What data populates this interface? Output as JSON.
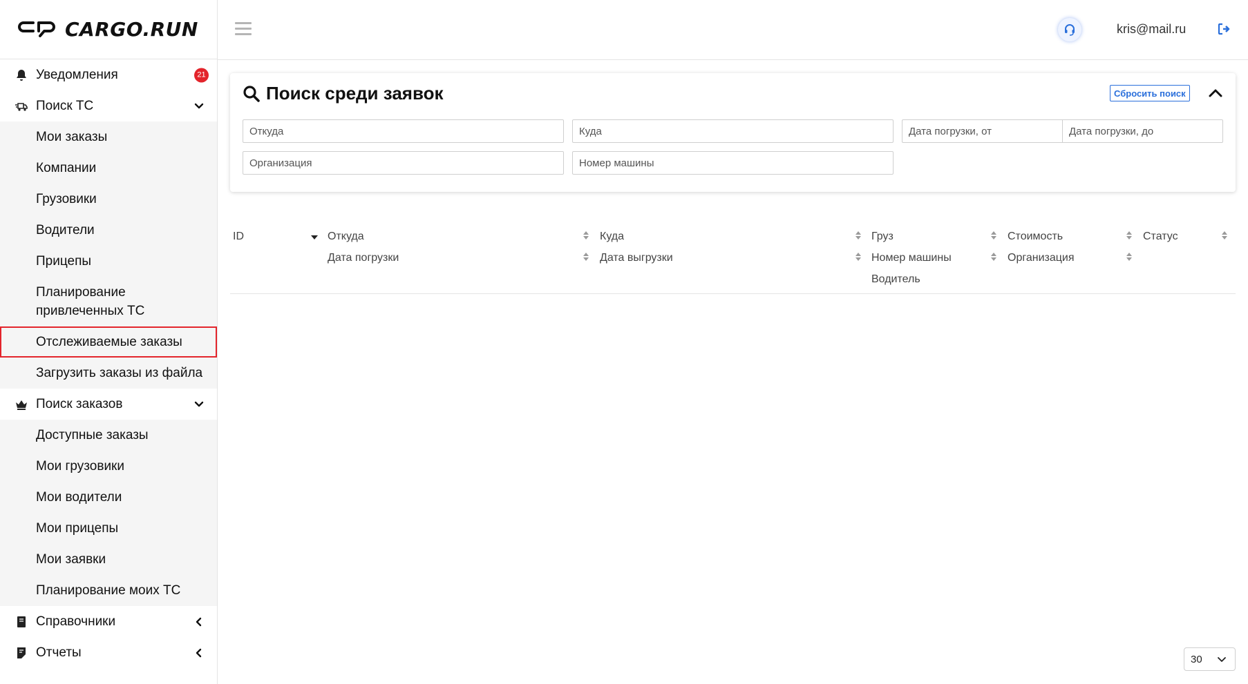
{
  "brand": {
    "name": "CARGO.RUN"
  },
  "header": {
    "user_email": "kris@mail.ru",
    "icons": [
      "menu-icon",
      "support-headset-icon",
      "logout-icon"
    ]
  },
  "sidebar": {
    "notifications": {
      "label": "Уведомления",
      "badge": "21"
    },
    "vehicle_search": {
      "label": "Поиск ТС",
      "items": [
        "Мои заказы",
        "Компании",
        "Грузовики",
        "Водители",
        "Прицепы",
        "Планирование привлеченных ТС",
        "Отслеживаемые заказы",
        "Загрузить заказы из файла"
      ],
      "selected": "Отслеживаемые заказы"
    },
    "order_search": {
      "label": "Поиск заказов",
      "items": [
        "Доступные заказы",
        "Мои грузовики",
        "Мои водители",
        "Мои прицепы",
        "Мои заявки",
        "Планирование моих ТС"
      ]
    },
    "references": {
      "label": "Справочники"
    },
    "reports": {
      "label": "Отчеты"
    }
  },
  "search": {
    "title": "Поиск среди заявок",
    "reset_label": "Сбросить поиск",
    "placeholders": {
      "from": "Откуда",
      "to": "Куда",
      "date_from": "Дата погрузки, от",
      "date_to": "Дата погрузки, до",
      "organization": "Организация",
      "plate": "Номер машины"
    }
  },
  "table": {
    "headers": {
      "id": "ID",
      "from": "Откуда",
      "load_date": "Дата погрузки",
      "to": "Куда",
      "unload_date": "Дата выгрузки",
      "cargo": "Груз",
      "plate": "Номер машины",
      "driver": "Водитель",
      "cost": "Стоимость",
      "organization": "Организация",
      "status": "Статус"
    }
  },
  "pagination": {
    "per_page": "30"
  },
  "colors": {
    "accent": "#2a6fdb",
    "badge": "#e3242b",
    "selected_border": "#e3242b"
  }
}
